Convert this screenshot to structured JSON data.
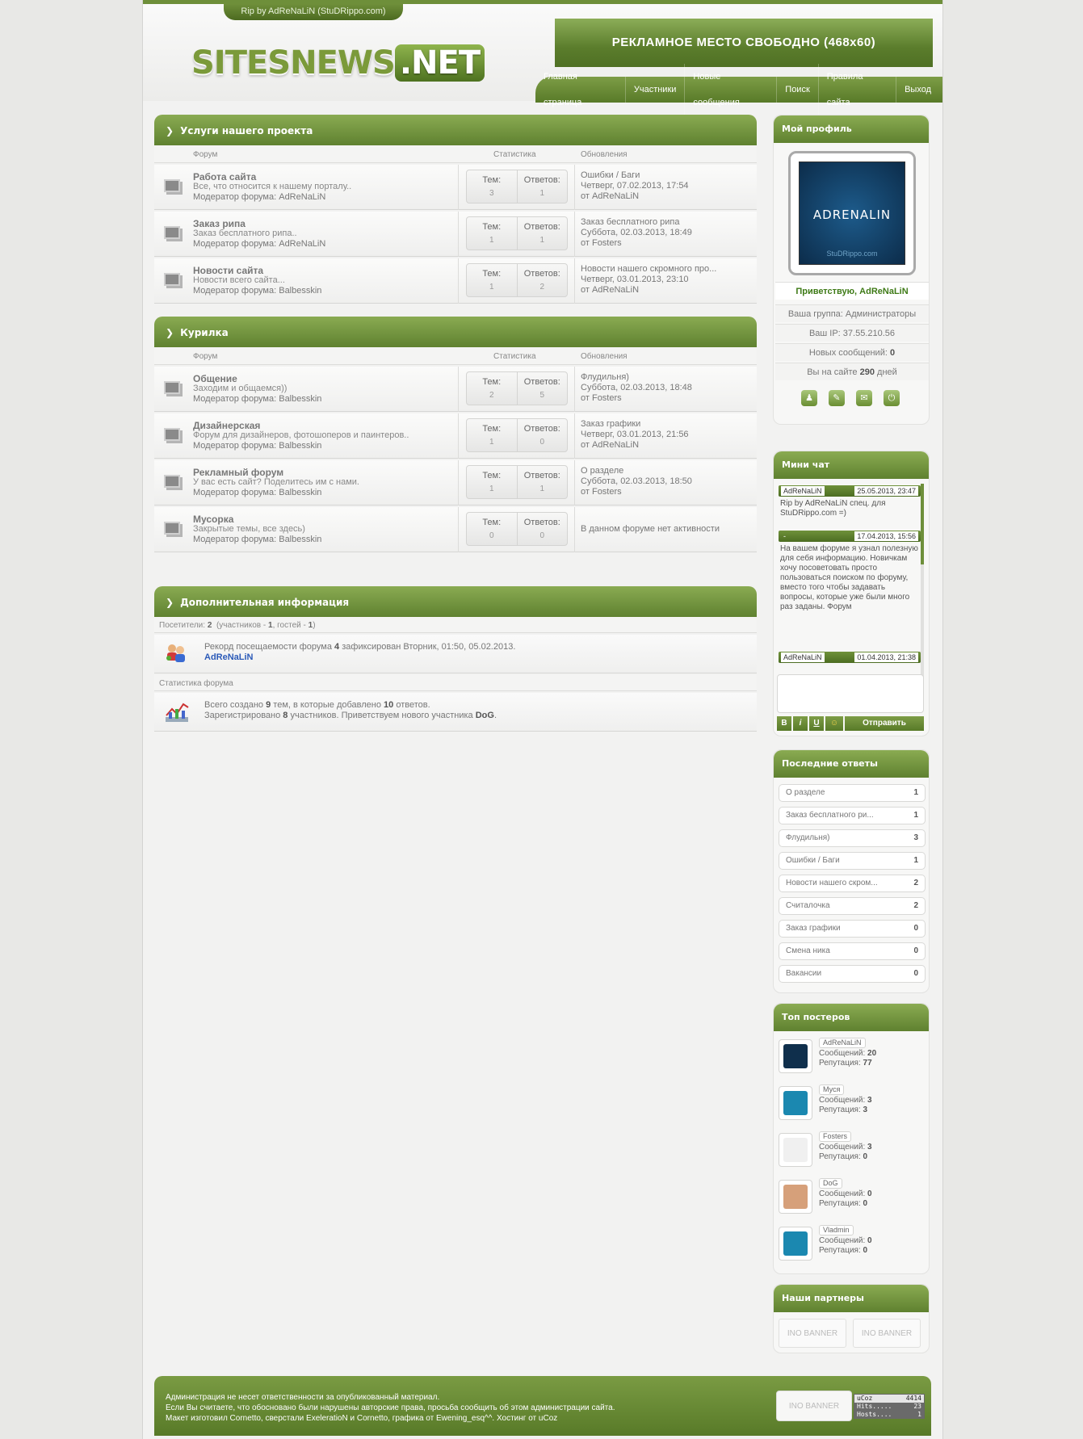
{
  "header": {
    "rip_text": "Rip by AdReNaLiN (StuDRippo.com)",
    "logo_main": "SITESNEWS",
    "logo_dot": ".NET",
    "ad_text": "РЕКЛАМНОЕ МЕСТО СВОБОДНО (468х60)"
  },
  "nav": [
    "Главная страница",
    "Участники",
    "Новые сообщения",
    "Поиск",
    "Правила сайта",
    "Выход"
  ],
  "columns": {
    "forum": "Форум",
    "stats": "Статистика",
    "updates": "Обновления"
  },
  "stats_labels": {
    "topics": "Тем:",
    "replies": "Ответов:"
  },
  "sections": [
    {
      "title": "Услуги нашего проекта",
      "forums": [
        {
          "name": "Работа сайта",
          "desc": "Все, что относится к нашему порталу..",
          "moderator": "Модератор форума: AdReNaLiN",
          "topics": "3",
          "replies": "1",
          "upd1": "Ошибки / Баги",
          "upd2": "Четверг, 07.02.2013, 17:54",
          "upd3": "от AdReNaLiN"
        },
        {
          "name": "Заказ рипа",
          "desc": "Заказ бесплатного рипа..",
          "moderator": "Модератор форума: AdReNaLiN",
          "topics": "1",
          "replies": "1",
          "upd1": "Заказ бесплатного рипа",
          "upd2": "Суббота, 02.03.2013, 18:49",
          "upd3": "от Fosters"
        },
        {
          "name": "Новости сайта",
          "desc": "Новости всего сайта...",
          "moderator": "Модератор форума: Balbesskin",
          "topics": "1",
          "replies": "2",
          "upd1": "Новости нашего скромного про...",
          "upd2": "Четверг, 03.01.2013, 23:10",
          "upd3": "от AdReNaLiN"
        }
      ]
    },
    {
      "title": "Курилка",
      "forums": [
        {
          "name": "Общение",
          "desc": "Заходим и общаемся))",
          "moderator": "Модератор форума: Balbesskin",
          "topics": "2",
          "replies": "5",
          "upd1": "Флудильня)",
          "upd2": "Суббота, 02.03.2013, 18:48",
          "upd3": "от Fosters"
        },
        {
          "name": "Дизайнерская",
          "desc": "Форум для дизайнеров, фотошоперов и паинтеров..",
          "moderator": "Модератор форума: Balbesskin",
          "topics": "1",
          "replies": "0",
          "upd1": "Заказ графики",
          "upd2": "Четверг, 03.01.2013, 21:56",
          "upd3": "от AdReNaLiN"
        },
        {
          "name": "Рекламный форум",
          "desc": "У вас есть сайт? Поделитесь им с нами.",
          "moderator": "Модератор форума: Balbesskin",
          "topics": "1",
          "replies": "1",
          "upd1": "О разделе",
          "upd2": "Суббота, 02.03.2013, 18:50",
          "upd3": "от Fosters"
        },
        {
          "name": "Мусорка",
          "desc": "Закрытые темы, все здесь)",
          "moderator": "Модератор форума: Balbesskin",
          "topics": "0",
          "replies": "0",
          "upd_single": "В данном форуме нет активности"
        }
      ]
    }
  ],
  "extra": {
    "title": "Дополнительная информация",
    "visitors_label": "Посетители:",
    "visitors": "2",
    "visitors_detail_a": "(участников -",
    "members": "1",
    "visitors_detail_b": ", гостей -",
    "guests": "1",
    "visitors_detail_c": ")",
    "record_a": "Рекорд посещаемости форума",
    "record_n": "4",
    "record_b": "зафиксирован Вторник, 01:50, 05.02.2013.",
    "record_user": "AdReNaLiN",
    "stats_label": "Статистика форума",
    "st_a": "Всего создано",
    "st_topics": "9",
    "st_b": "тем, в которые добавлено",
    "st_replies": "10",
    "st_c": "ответов.",
    "st_d": "Зарегистрировано",
    "st_users": "8",
    "st_e": "участников. Приветствуем нового участника",
    "st_new": "DoG",
    "st_f": "."
  },
  "profile": {
    "title": "Мой профиль",
    "avatar_text": "ADRENALIN",
    "avatar_sub": "StuDRippo.com",
    "greeting": "Приветствую, AdReNaLiN",
    "group": "Ваша группа: Администраторы",
    "ip": "Ваш IP: 37.55.210.56",
    "new_msgs_label": "Новых сообщений:",
    "new_msgs": "0",
    "days_a": "Вы на сайте",
    "days_n": "290",
    "days_b": "дней"
  },
  "chat": {
    "title": "Мини чат",
    "messages": [
      {
        "name": "AdReNaLiN",
        "date": "25.05.2013, 23:47",
        "text": "Rip by AdReNaLiN спец. для StuDRippo.com =)"
      },
      {
        "name": "-",
        "date": "17.04.2013, 15:56",
        "text": "На вашем форуме я узнал полезную для себя информацию. Новичкам хочу посоветовать просто пользоваться поиском по форуму, вместо того чтобы задавать вопросы, которые уже были много раз заданы. Форум"
      },
      {
        "name": "AdReNaLiN",
        "date": "01.04.2013, 21:38",
        "text": ""
      }
    ],
    "btn_b": "B",
    "btn_i": "i",
    "btn_u": "U",
    "btn_smile": "☺",
    "send": "Отправить"
  },
  "latest": {
    "title": "Последние ответы",
    "items": [
      {
        "t": "О разделе",
        "c": "1"
      },
      {
        "t": "Заказ бесплатного ри...",
        "c": "1"
      },
      {
        "t": "Флудильня)",
        "c": "3"
      },
      {
        "t": "Ошибки / Баги",
        "c": "1"
      },
      {
        "t": "Новости нашего скром...",
        "c": "2"
      },
      {
        "t": "Считалочка",
        "c": "2"
      },
      {
        "t": "Заказ графики",
        "c": "0"
      },
      {
        "t": "Смена ника",
        "c": "0"
      },
      {
        "t": "Вакансии",
        "c": "0"
      }
    ]
  },
  "top": {
    "title": "Топ постеров",
    "msg_label": "Сообщений:",
    "rep_label": "Репутация:",
    "posters": [
      {
        "name": "AdReNaLiN",
        "msgs": "20",
        "rep": "77",
        "color": "#0f2f4c"
      },
      {
        "name": "Муся",
        "msgs": "3",
        "rep": "3",
        "color": "#1b88b0"
      },
      {
        "name": "Fosters",
        "msgs": "3",
        "rep": "0",
        "color": "#f0f0f0"
      },
      {
        "name": "DoG",
        "msgs": "0",
        "rep": "0",
        "color": "#d6a07a"
      },
      {
        "name": "Vladmin",
        "msgs": "0",
        "rep": "0",
        "color": "#1b88b0"
      }
    ]
  },
  "partners": {
    "title": "Наши партнеры",
    "banner": "INO BANNER"
  },
  "footer": {
    "line1": "Администрация не несет ответственности за опубликованный материал.",
    "line2": "Если Вы считаете, что обосновано были нарушены авторские права, просьба сообщить об этом администрации сайта.",
    "line3": "Макет изготовил Cornetto, сверстали ExeleratioN и Cornetto, графика от Ewening_esq^^. Хостинг от uCoz",
    "banner": "INO BANNER",
    "counter": {
      "brand": "uCoz",
      "total": "4414",
      "hits_label": "Hits.....",
      "hits": "23",
      "hosts_label": "Hosts....",
      "hosts": "1"
    }
  }
}
